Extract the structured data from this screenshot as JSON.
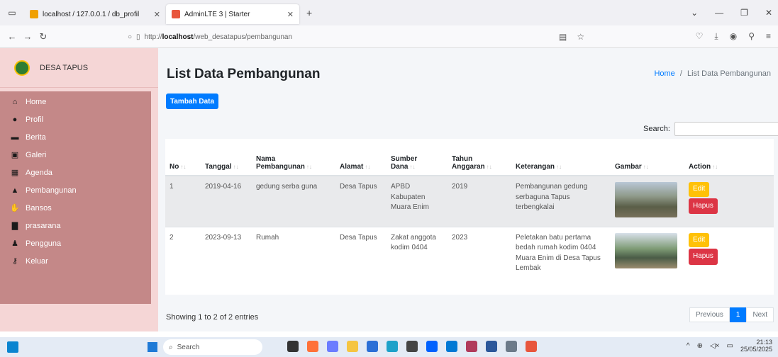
{
  "browser": {
    "tabs": [
      {
        "title": "localhost / 127.0.0.1 / db_profil",
        "icon_color": "#f0a000"
      },
      {
        "title": "AdminLTE 3 | Starter",
        "icon_color": "#e8563d"
      }
    ],
    "url_prefix": "http://",
    "url_host": "localhost",
    "url_path": "/web_desatapus/pembangunan"
  },
  "sidebar": {
    "brand": "DESA TAPUS",
    "items": [
      {
        "label": "Home",
        "icon": "house-icon"
      },
      {
        "label": "Profil",
        "icon": "user-circle-icon"
      },
      {
        "label": "Berita",
        "icon": "newspaper-icon"
      },
      {
        "label": "Galeri",
        "icon": "image-icon"
      },
      {
        "label": "Agenda",
        "icon": "calendar-icon"
      },
      {
        "label": "Pembangunan",
        "icon": "building-icon"
      },
      {
        "label": "Bansos",
        "icon": "hand-icon"
      },
      {
        "label": "prasarana",
        "icon": "city-icon"
      },
      {
        "label": "Pengguna",
        "icon": "user-icon"
      },
      {
        "label": "Keluar",
        "icon": "key-icon"
      }
    ]
  },
  "page": {
    "title": "List Data Pembangunan",
    "breadcrumb_home": "Home",
    "breadcrumb_sep": "/",
    "breadcrumb_current": "List Data Pembangunan",
    "add_button": "Tambah Data",
    "search_label": "Search:",
    "search_value": ""
  },
  "table": {
    "headers": [
      "No",
      "Tanggal",
      "Nama Pembangunan",
      "Alamat",
      "Sumber Dana",
      "Tahun Anggaran",
      "Keterangan",
      "Gambar",
      "Action"
    ],
    "rows": [
      {
        "no": "1",
        "tanggal": "2019-04-16",
        "nama": "gedung serba guna",
        "alamat": "Desa Tapus",
        "sumber": "APBD Kabupaten Muara Enim",
        "tahun": "2019",
        "keterangan": "Pembangunan gedung serbaguna Tapus terbengkalai"
      },
      {
        "no": "2",
        "tanggal": "2023-09-13",
        "nama": "Rumah",
        "alamat": "Desa Tapus",
        "sumber": "Zakat anggota kodim 0404",
        "tahun": "2023",
        "keterangan": "Peletakan batu pertama bedah rumah kodim 0404 Muara Enim di Desa Tapus Lembak"
      }
    ],
    "edit_label": "Edit",
    "delete_label": "Hapus"
  },
  "footer": {
    "info": "Showing 1 to 2 of 2 entries",
    "prev": "Previous",
    "page": "1",
    "next": "Next"
  },
  "taskbar": {
    "search": "Search",
    "time": "21:13",
    "date": "25/05/2025"
  }
}
